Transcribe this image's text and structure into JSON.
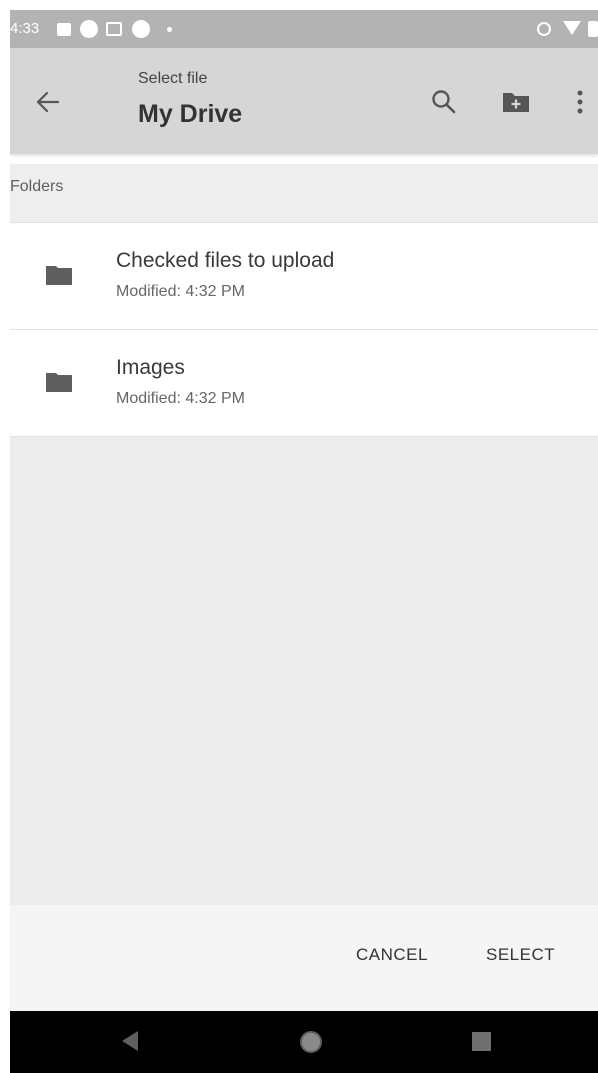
{
  "status_bar": {
    "time": "4:33",
    "icons": [
      "image-icon",
      "circle-icon",
      "gmail-icon",
      "circle-icon",
      "dot-icon",
      "vibrate-icon",
      "wifi-icon",
      "battery-icon"
    ]
  },
  "app_bar": {
    "subtitle": "Select file",
    "title": "My Drive",
    "icons": [
      "back-arrow-icon",
      "search-icon",
      "new-folder-icon",
      "more-vert-icon"
    ]
  },
  "section": {
    "folders_label": "Folders"
  },
  "folders": [
    {
      "name": "Checked files to upload",
      "modified": "Modified: 4:32 PM",
      "icon": "folder-icon"
    },
    {
      "name": "Images",
      "modified": "Modified: 4:32 PM",
      "icon": "folder-icon"
    }
  ],
  "actions": {
    "cancel": "CANCEL",
    "select": "SELECT"
  },
  "nav_bar": {
    "icons": [
      "nav-back-icon",
      "nav-home-icon",
      "nav-recents-icon"
    ]
  },
  "colors": {
    "status_bar": "#b3b3b3",
    "app_bar": "#d6d6d6",
    "section_header": "#eeeeee",
    "empty_area": "#ececec",
    "nav_bar": "#000000"
  }
}
